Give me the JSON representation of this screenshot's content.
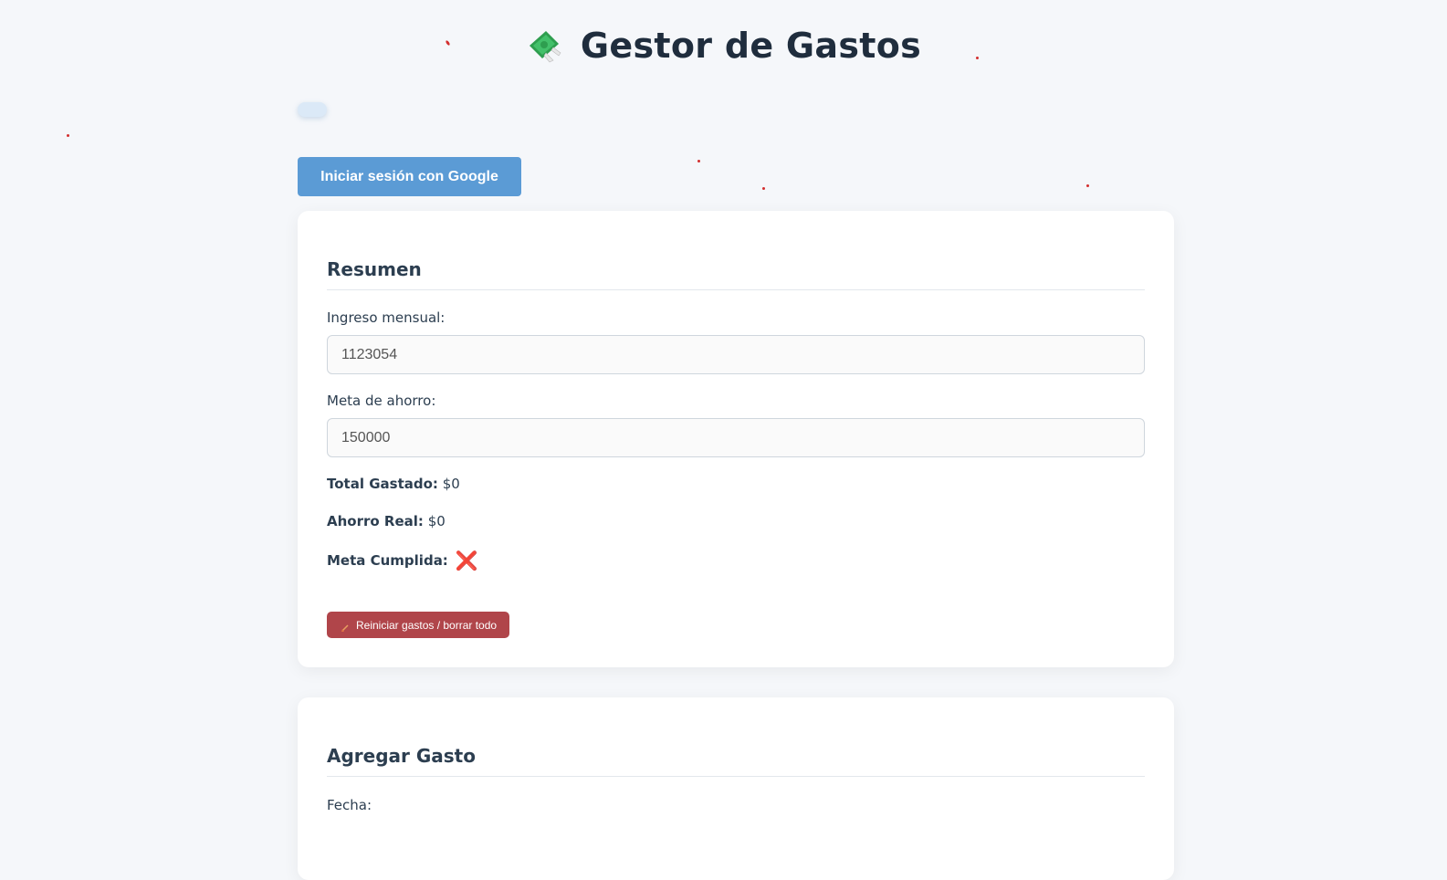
{
  "header": {
    "title": "Gestor de Gastos",
    "icon": "money-with-wings-icon"
  },
  "auth": {
    "google_button_label": "Iniciar sesión con Google"
  },
  "summary": {
    "section_title": "Resumen",
    "income_label": "Ingreso mensual:",
    "income_value": "1123054",
    "savings_goal_label": "Meta de ahorro:",
    "savings_goal_value": "150000",
    "total_spent_label": "Total Gastado:",
    "total_spent_value": "$0",
    "real_savings_label": "Ahorro Real:",
    "real_savings_value": "$0",
    "goal_met_label": "Meta Cumplida:",
    "goal_met_value": "❌",
    "reset_button_label": "Reiniciar gastos / borrar todo",
    "reset_icon": "broom-icon"
  },
  "add_expense": {
    "section_title": "Agregar Gasto",
    "date_label": "Fecha:"
  },
  "colors": {
    "background": "#f5f7fa",
    "google_button": "#5b9bd5",
    "reset_button": "#b0454a",
    "x_mark": "#e0425e"
  }
}
